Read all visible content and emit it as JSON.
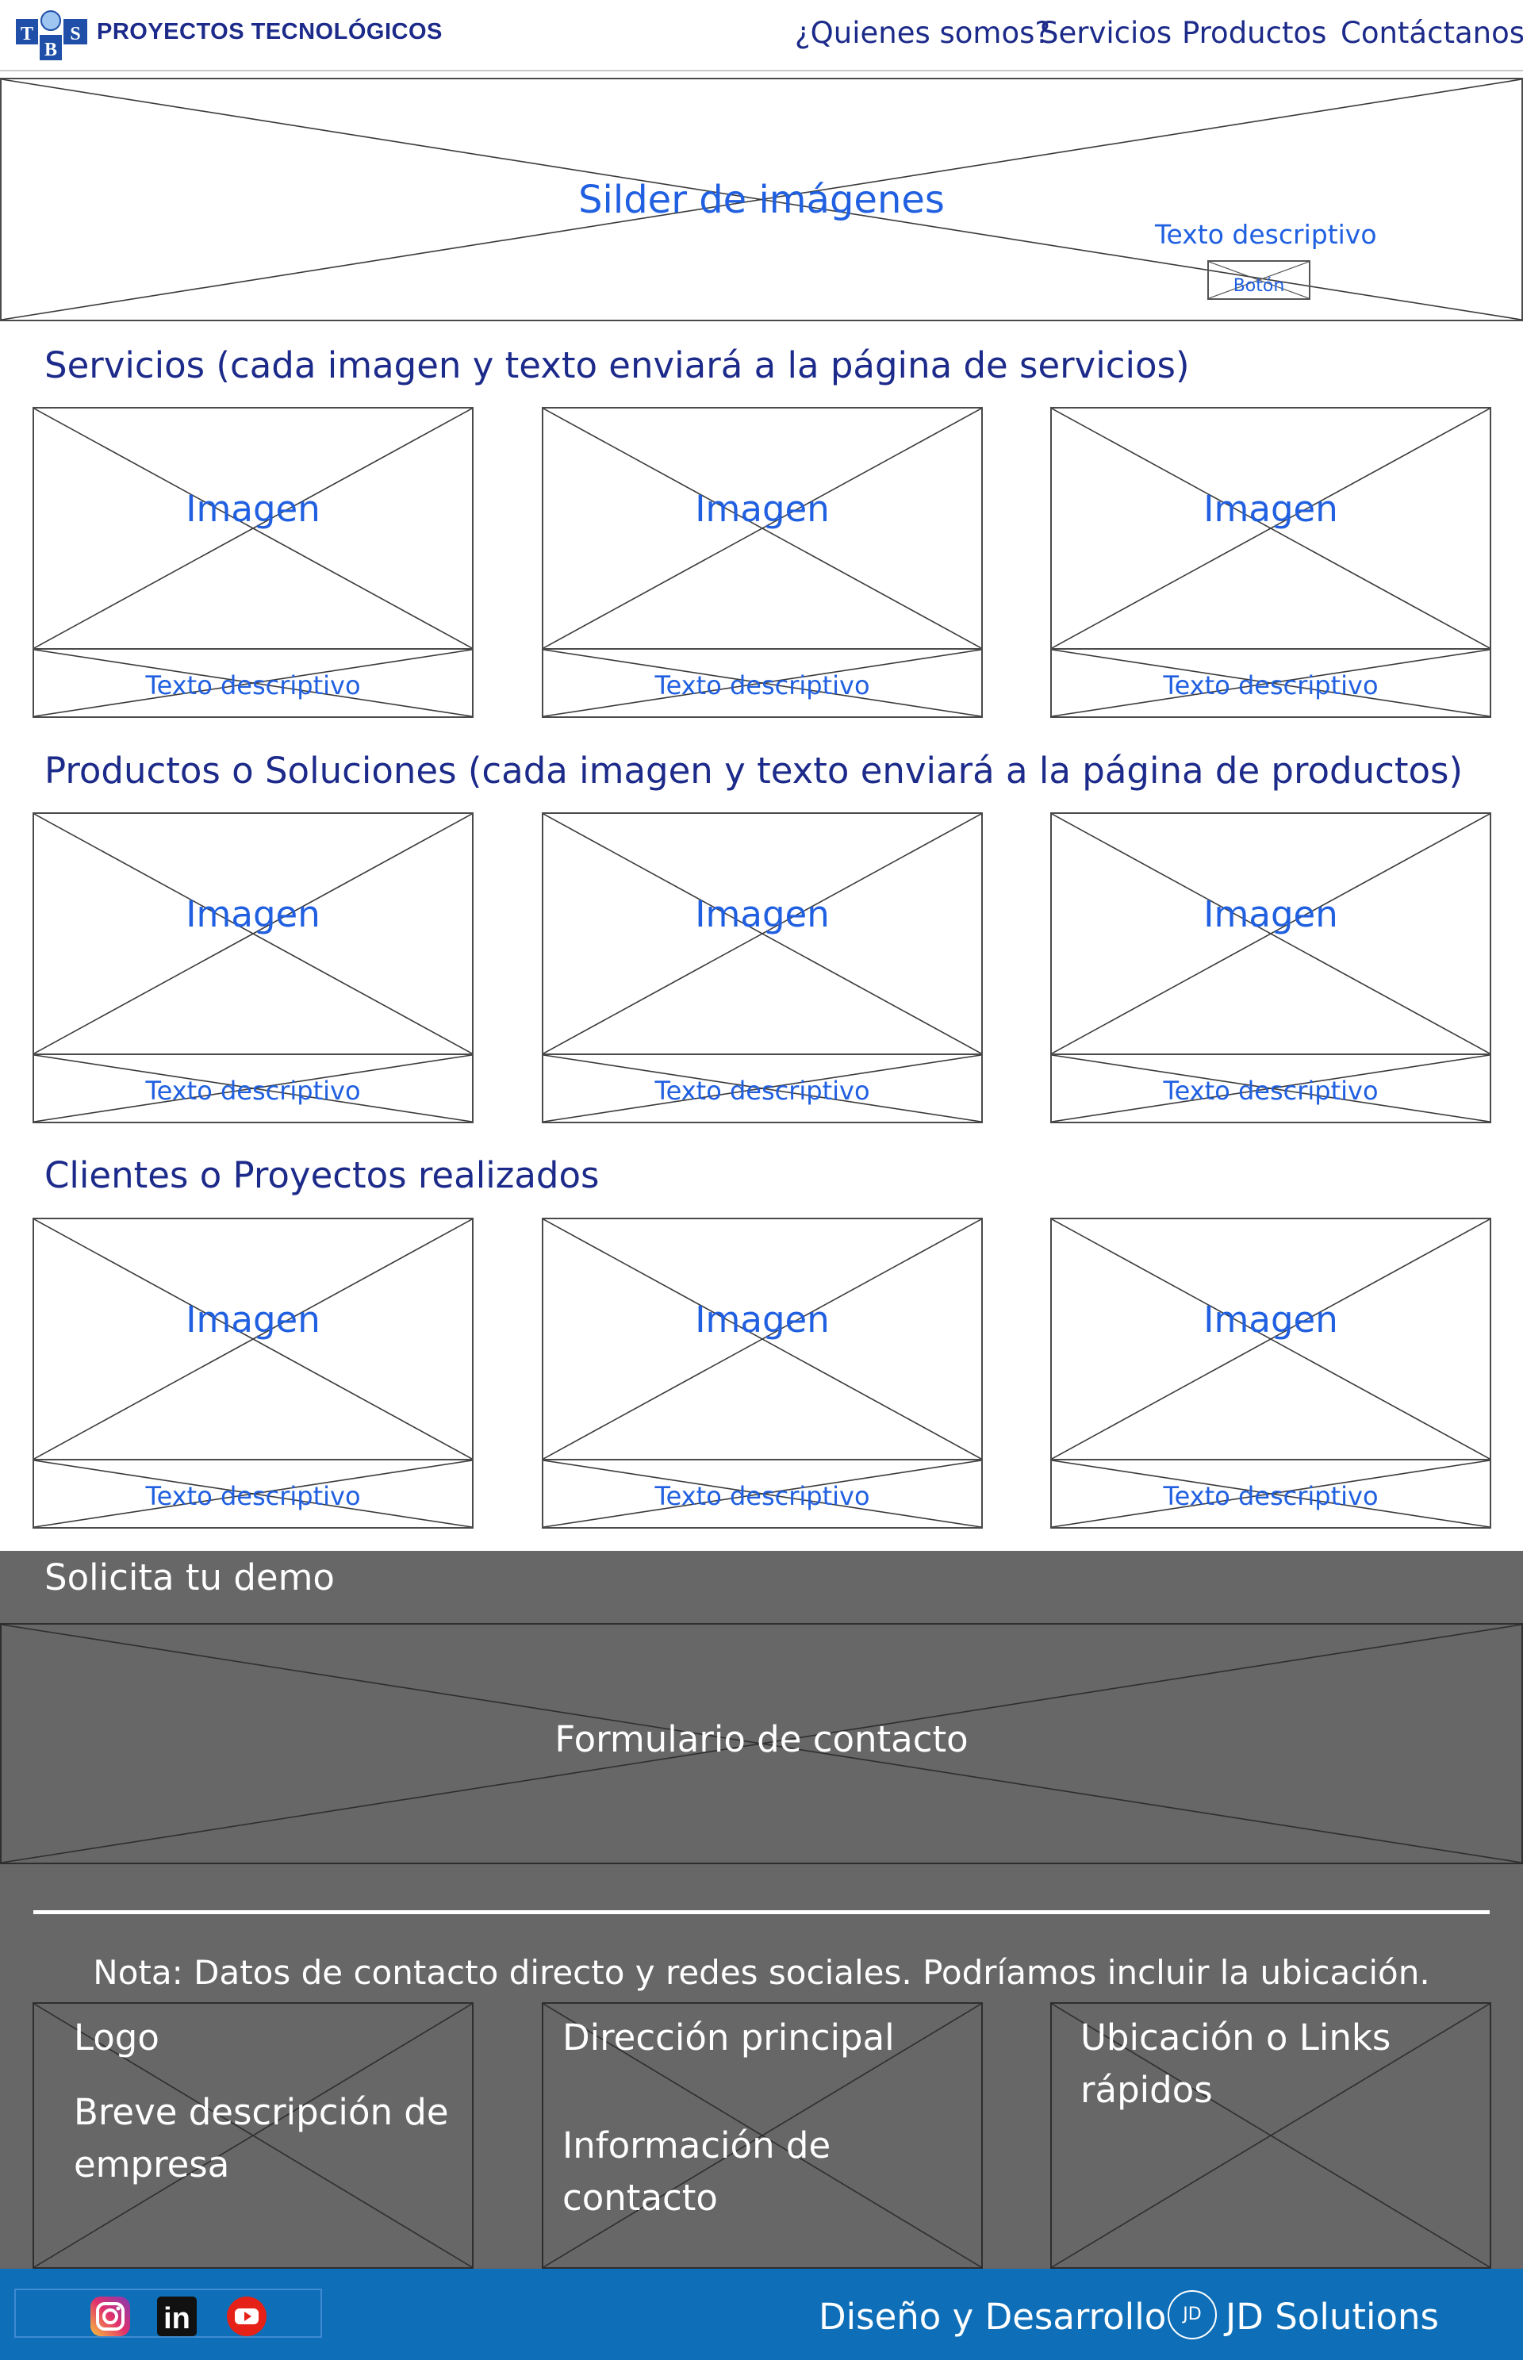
{
  "header": {
    "logo_letters": "TBS",
    "company_name": "PROYECTOS TECNOLÓGICOS",
    "nav": [
      "¿Quienes somos?",
      "Servicios",
      "Productos",
      "Contáctanos"
    ]
  },
  "slider": {
    "title": "Silder de imágenes",
    "description": "Texto descriptivo",
    "button": "Botón"
  },
  "services": {
    "title": "Servicios (cada imagen y texto enviará a la página de servicios)",
    "cards": [
      {
        "image": "Imagen",
        "text": "Texto descriptivo"
      },
      {
        "image": "Imagen",
        "text": "Texto descriptivo"
      },
      {
        "image": "Imagen",
        "text": "Texto descriptivo"
      }
    ]
  },
  "products": {
    "title": "Productos o Soluciones (cada imagen y texto enviará a la página de productos)",
    "cards": [
      {
        "image": "Imagen",
        "text": "Texto descriptivo"
      },
      {
        "image": "Imagen",
        "text": "Texto descriptivo"
      },
      {
        "image": "Imagen",
        "text": "Texto descriptivo"
      }
    ]
  },
  "clients": {
    "title": "Clientes o Proyectos realizados",
    "cards": [
      {
        "image": "Imagen",
        "text": "Texto descriptivo"
      },
      {
        "image": "Imagen",
        "text": "Texto descriptivo"
      },
      {
        "image": "Imagen",
        "text": "Texto descriptivo"
      }
    ]
  },
  "demo": {
    "title": "Solicita tu demo",
    "form": "Formulario de contacto"
  },
  "footer": {
    "note": "Nota: Datos de contacto directo y redes sociales. Podríamos incluir la ubicación.",
    "col1": {
      "line1": "Logo",
      "line2": "Breve descripción de empresa"
    },
    "col2": {
      "line1": "Dirección principal",
      "line2": "Información de contacto"
    },
    "col3": {
      "line1": "Ubicación o Links rápidos"
    }
  },
  "bottom_bar": {
    "social": [
      "instagram-icon",
      "linkedin-icon",
      "youtube-icon"
    ],
    "linkedin_glyph": "in",
    "credit": "Diseño y Desarrollo",
    "badge": "JD",
    "company": "JD Solutions"
  },
  "colors": {
    "nav_text": "#1c2a8a",
    "placeholder_text": "#2060e0",
    "demo_band": "#666766",
    "bottom_bar": "#0e6fb8"
  }
}
